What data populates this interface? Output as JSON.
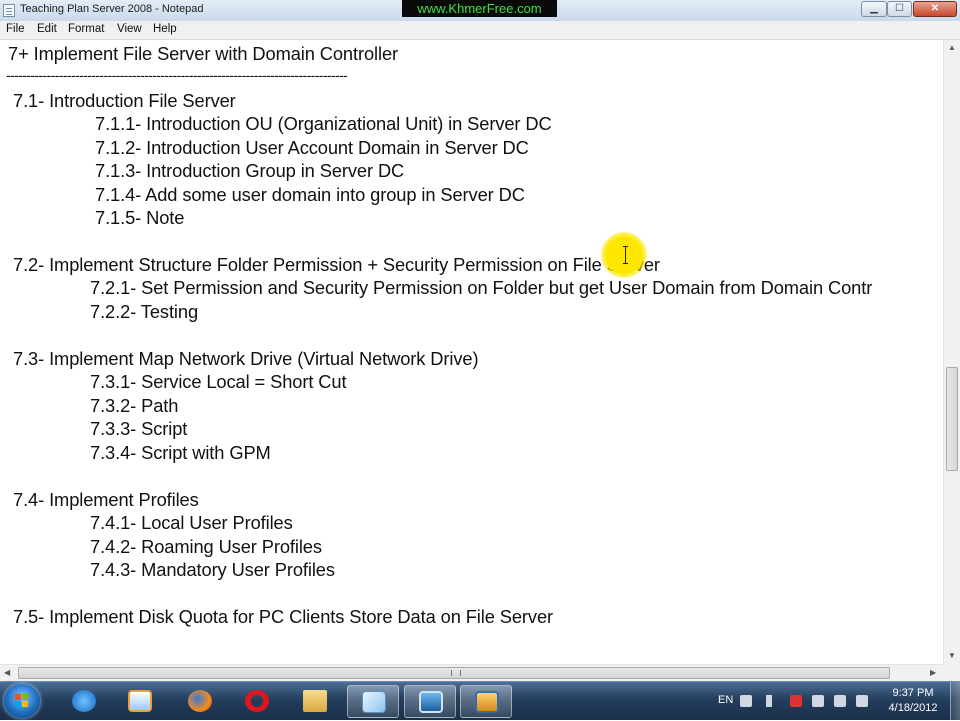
{
  "window": {
    "title": "Teaching Plan Server 2008 - Notepad",
    "watermark": "www.KhmerFree.com",
    "controls": {
      "minimize": "▁",
      "maximize": "☐",
      "close": "✕"
    }
  },
  "menu": [
    "File",
    "Edit",
    "Format",
    "View",
    "Help"
  ],
  "editor": {
    "lines": [
      "7+ Implement File Server with Domain Controller",
      "------------------------------------------------------------------------------------",
      "7.1- Introduction File Server",
      "7.1.1- Introduction OU (Organizational Unit) in Server DC",
      "7.1.2- Introduction User Account Domain in Server DC",
      "7.1.3- Introduction Group in Server DC",
      "7.1.4- Add some user domain into group in Server DC",
      "7.1.5- Note",
      "7.2- Implement Structure Folder Permission + Security Permission on File Server",
      "7.2.1- Set Permission and Security Permission on Folder but get User Domain from Domain Contr",
      "7.2.2- Testing",
      "7.3- Implement Map Network Drive (Virtual Network Drive)",
      "7.3.1- Service Local = Short Cut",
      "7.3.2- Path",
      "7.3.3- Script",
      "7.3.4- Script with GPM",
      "7.4- Implement Profiles",
      "7.4.1- Local User Profiles",
      "7.4.2- Roaming User Profiles",
      "7.4.3- Mandatory User Profiles",
      "7.5- Implement Disk Quota for PC Clients Store Data on File Server"
    ]
  },
  "taskbar": {
    "language": "EN",
    "time": "9:37 PM",
    "date": "4/18/2012",
    "icons": [
      "start-orb",
      "internet-explorer-icon",
      "media-player-icon",
      "firefox-icon",
      "opera-icon",
      "windows-explorer-icon",
      "notepad-icon",
      "remote-desktop-icon",
      "virtualbox-icon"
    ]
  },
  "colors": {
    "highlight": "#ffe600",
    "watermark_text": "#3fe03f",
    "taskbar": "#243e5d"
  }
}
